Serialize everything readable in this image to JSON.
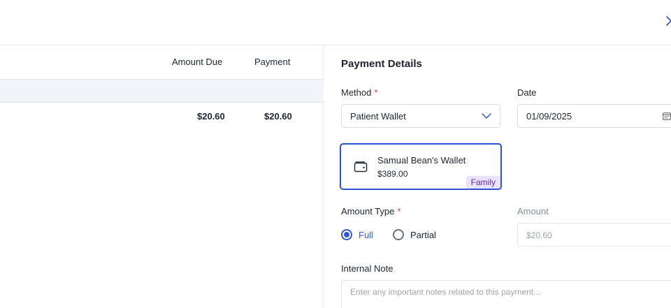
{
  "table": {
    "headers": {
      "amount_due": "Amount Due",
      "payment": "Payment"
    },
    "rows": [
      {
        "amount_due": "$20.60",
        "payment": "$20.60"
      }
    ]
  },
  "payment_details": {
    "title": "Payment Details",
    "method": {
      "label": "Method",
      "required_mark": "*",
      "value": "Patient Wallet"
    },
    "date": {
      "label": "Date",
      "value": "01/09/2025"
    },
    "wallet": {
      "name": "Samual Bean's Wallet",
      "balance": "$389.00",
      "badge": "Family",
      "icon": "wallet-icon"
    },
    "amount_type": {
      "label": "Amount Type",
      "required_mark": "*",
      "options": [
        {
          "label": "Full",
          "selected": true
        },
        {
          "label": "Partial",
          "selected": false
        }
      ]
    },
    "amount": {
      "label": "Amount",
      "value": "$20.60"
    },
    "internal_note": {
      "label": "Internal Note",
      "placeholder": "Enter any important notes related to this payment..."
    }
  },
  "colors": {
    "accent": "#2f59d9",
    "selected_border": "#2f4fd3",
    "badge_bg": "#ebe3fb",
    "badge_text": "#5e2bb0",
    "required": "#d64545"
  }
}
